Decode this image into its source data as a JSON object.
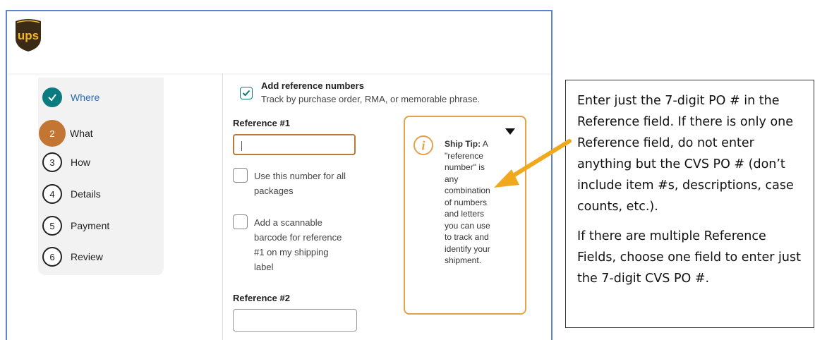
{
  "logo": {
    "text": "ups",
    "color": "#3b2a16",
    "accent": "#f4b521"
  },
  "steps": [
    {
      "number": "",
      "label": "Where",
      "state": "done"
    },
    {
      "number": "2",
      "label": "What",
      "state": "active"
    },
    {
      "number": "3",
      "label": "How",
      "state": "pending"
    },
    {
      "number": "4",
      "label": "Details",
      "state": "pending"
    },
    {
      "number": "5",
      "label": "Payment",
      "state": "pending"
    },
    {
      "number": "6",
      "label": "Review",
      "state": "pending"
    }
  ],
  "form": {
    "add_reference_label": "Add reference numbers",
    "add_reference_checked": true,
    "add_reference_desc": "Track by purchase order, RMA, or memorable phrase.",
    "reference1_label": "Reference #1",
    "reference1_value": "",
    "use_for_all_line1": "Use this number for all",
    "use_for_all_line2": "packages",
    "barcode_line1": "Add a scannable",
    "barcode_line2": "barcode for reference",
    "barcode_line3": "#1 on my shipping",
    "barcode_line4": "label",
    "reference2_label": "Reference #2",
    "reference2_value": ""
  },
  "tip": {
    "icon": "info-icon",
    "title": "Ship Tip:",
    "lines": [
      "A",
      "\"reference",
      "number\" is",
      "any",
      "combination",
      "of numbers",
      "and letters",
      "you can use",
      "to track and",
      "identify your",
      "shipment."
    ]
  },
  "callout": {
    "paragraph1": "Enter just the 7-digit PO # in the Reference field. If there is only one Reference field, do not enter anything but the CVS PO # (don’t include item #s, descriptions, case counts, etc.).",
    "paragraph2": "If there are multiple Reference Fields, choose one field to enter just the 7-digit CVS PO #."
  },
  "colors": {
    "frame_border": "#5b86c7",
    "step_done": "#0a7b7e",
    "step_active": "#c37633",
    "tip_border": "#e7a146",
    "arrow": "#f0a81c"
  }
}
